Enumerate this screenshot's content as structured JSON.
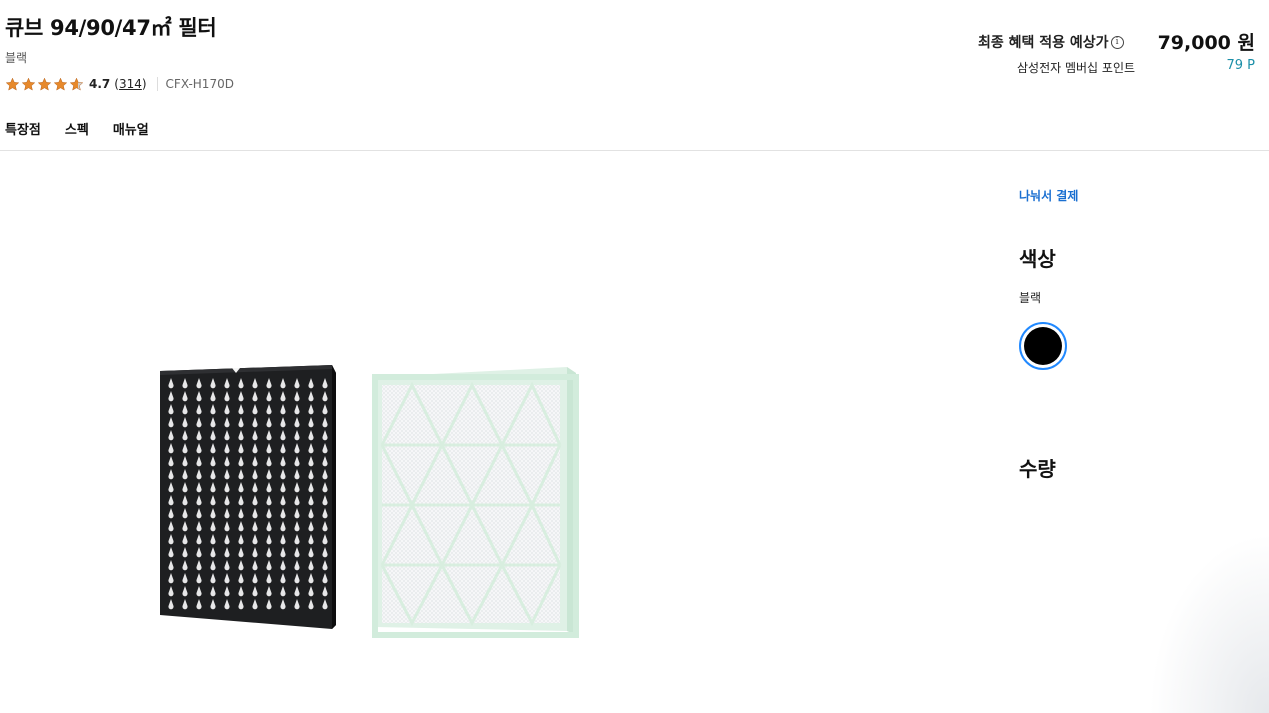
{
  "product": {
    "title": "큐브 94/90/47㎡ 필터",
    "color_label": "블랙",
    "rating": "4.7",
    "review_count": "314",
    "review_open": "(",
    "review_close": ")",
    "model_code": "CFX-H170D"
  },
  "price": {
    "label": "최종 혜택 적용 예상가",
    "info_symbol": "i",
    "value": "79,000 원",
    "points_label": "삼성전자 멤버십 포인트",
    "points_value": "79 P"
  },
  "tabs": [
    {
      "label": "특장점"
    },
    {
      "label": "스펙"
    },
    {
      "label": "매뉴얼"
    }
  ],
  "options": {
    "installment_link": "나눠서 결제",
    "color_heading": "색상",
    "color_selected": "블랙",
    "swatch_color": "#000000",
    "quantity_heading": "수량"
  },
  "colors": {
    "star": "#e7892b",
    "accent_blue": "#2189ff",
    "points_teal": "#1b8fa8",
    "link_blue": "#1a6fd1"
  },
  "icons": {
    "star": "star-icon",
    "info": "info-circle-icon"
  }
}
